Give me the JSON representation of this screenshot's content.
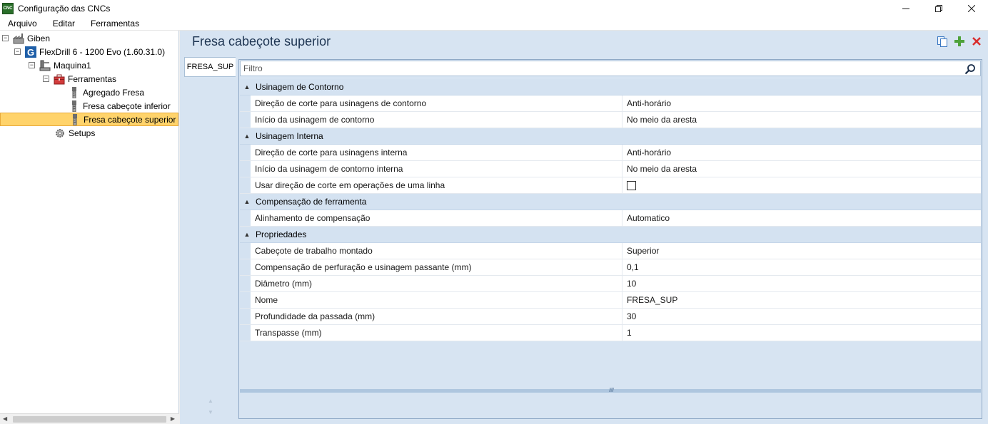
{
  "window": {
    "title": "Configuração das CNCs",
    "icon_text": "CNC",
    "controls": [
      "minimize",
      "maximize",
      "close"
    ]
  },
  "menu": [
    "Arquivo",
    "Editar",
    "Ferramentas"
  ],
  "tree": [
    {
      "label": "Giben",
      "level": 0,
      "icon": "factory-icon",
      "expander": "⊟"
    },
    {
      "label": "FlexDrill 6 - 1200 Evo (1.60.31.0)",
      "level": 1,
      "icon": "g-logo-icon",
      "expander": "⊟"
    },
    {
      "label": "Maquina1",
      "level": 2,
      "icon": "machine-icon",
      "expander": "⊟"
    },
    {
      "label": "Ferramentas",
      "level": 3,
      "icon": "toolbox-icon",
      "expander": "⊟"
    },
    {
      "label": "Agregado Fresa",
      "level": 4,
      "icon": "cutter-icon"
    },
    {
      "label": "Fresa cabeçote inferior",
      "level": 4,
      "icon": "cutter-icon"
    },
    {
      "label": "Fresa cabeçote superior",
      "level": 4,
      "icon": "cutter-icon",
      "selected": true
    },
    {
      "label": "Setups",
      "level": 3,
      "icon": "gear-icon"
    }
  ],
  "header": {
    "title": "Fresa cabeçote superior",
    "actions": [
      "copy-icon",
      "add-icon",
      "delete-icon"
    ]
  },
  "tabs": [
    "FRESA_SUP"
  ],
  "filter": {
    "placeholder": "Filtro",
    "value": ""
  },
  "categories": [
    {
      "name": "Usinagem de Contorno",
      "properties": [
        {
          "name": "Direção de corte para usinagens de contorno",
          "value": "Anti-horário"
        },
        {
          "name": "Início da usinagem de contorno",
          "value": "No meio da aresta"
        }
      ]
    },
    {
      "name": "Usinagem Interna",
      "properties": [
        {
          "name": "Direção de corte para usinagens interna",
          "value": "Anti-horário"
        },
        {
          "name": "Início da usinagem de contorno interna",
          "value": "No meio da aresta"
        },
        {
          "name": "Usar direção de corte em operações de uma linha",
          "value": "",
          "checkbox": true,
          "checked": false
        }
      ]
    },
    {
      "name": "Compensação de ferramenta",
      "properties": [
        {
          "name": "Alinhamento de compensação",
          "value": "Automatico"
        }
      ]
    },
    {
      "name": "Propriedades",
      "properties": [
        {
          "name": "Cabeçote de trabalho montado",
          "value": "Superior"
        },
        {
          "name": "Compensação de perfuração e usinagem passante (mm)",
          "value": "0,1"
        },
        {
          "name": "Diâmetro (mm)",
          "value": "10"
        },
        {
          "name": "Nome",
          "value": "FRESA_SUP"
        },
        {
          "name": "Profundidade da passada (mm)",
          "value": "30"
        },
        {
          "name": "Transpasse (mm)",
          "value": "1"
        }
      ]
    }
  ]
}
